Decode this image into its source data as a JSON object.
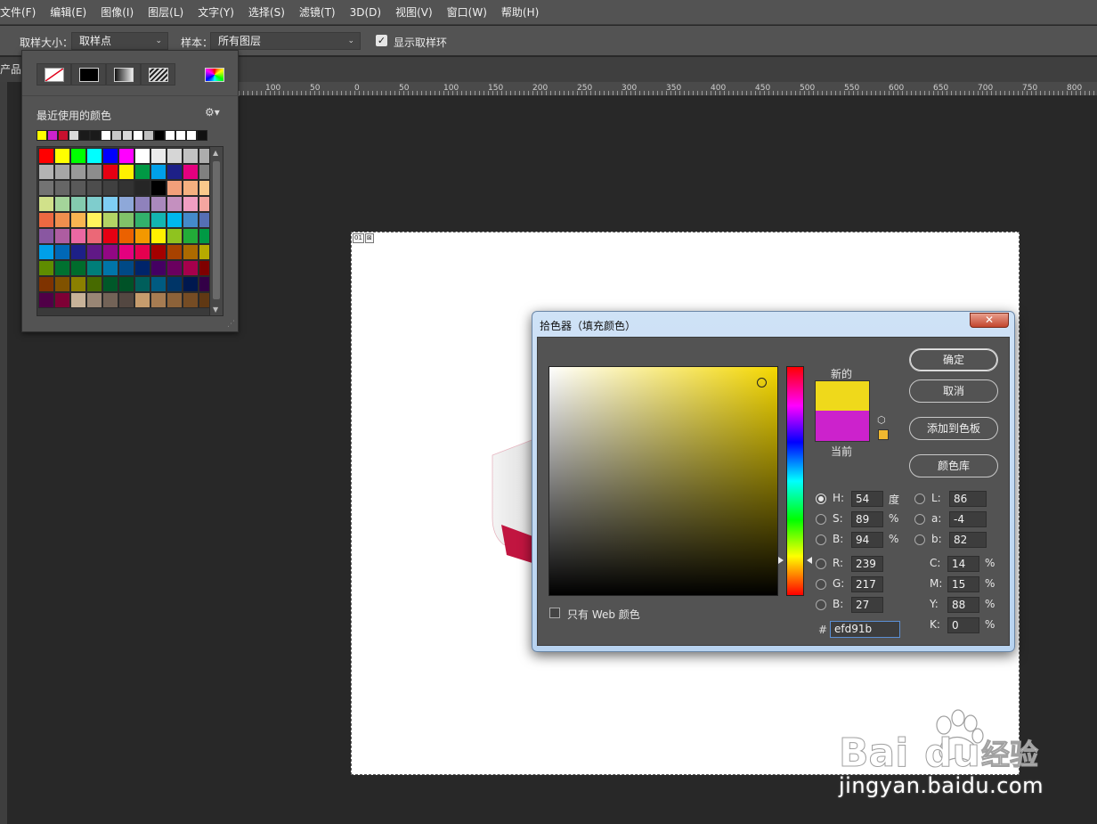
{
  "menu": [
    "文件(F)",
    "编辑(E)",
    "图像(I)",
    "图层(L)",
    "文字(Y)",
    "选择(S)",
    "滤镜(T)",
    "3D(D)",
    "视图(V)",
    "窗口(W)",
    "帮助(H)"
  ],
  "options": {
    "sample_size_label": "取样大小：",
    "sample_size_value": "取样点",
    "sample_label": "样本：",
    "sample_value": "所有图层",
    "show_ring_label": "显示取样环"
  },
  "doc_tab": "产品",
  "ruler_labels": [
    "100",
    "50",
    "0",
    "50",
    "100",
    "150",
    "200",
    "250",
    "300",
    "350",
    "400",
    "450",
    "500",
    "550",
    "600",
    "650",
    "700",
    "750",
    "800"
  ],
  "doc_badge": [
    "01",
    "⊠"
  ],
  "swatch_panel": {
    "recent_title": "最近使用的颜色",
    "recent_colors": [
      "#ffff00",
      "#cc22cc",
      "#c8102e",
      "#d9d9d9",
      "#1a1a1a",
      "#1a1a1a",
      "#ffffff",
      "#c8c8c8",
      "#d9d9d9",
      "#ffffff",
      "#bfbfbf",
      "#000000",
      "#ffffff",
      "#ffffff",
      "#ffffff",
      "#111111"
    ],
    "grid_colors": [
      "#ff0000",
      "#ffff00",
      "#00ff00",
      "#00ffff",
      "#0000ff",
      "#ff00ff",
      "#ffffff",
      "#ebebeb",
      "#d6d6d6",
      "#c2c2c2",
      "#adadad",
      "#b3b3b3",
      "#a6a6a6",
      "#999999",
      "#8c8c8c",
      "#e60012",
      "#fff100",
      "#009944",
      "#00a0e9",
      "#1d2088",
      "#e4007f",
      "#808080",
      "#737373",
      "#666666",
      "#595959",
      "#4d4d4d",
      "#404040",
      "#333333",
      "#262626",
      "#000000",
      "#f19f7a",
      "#f5b080",
      "#f9c98b",
      "#d1e18a",
      "#a4d49a",
      "#84cbaf",
      "#7fcdcd",
      "#7ecef4",
      "#8ea8d9",
      "#8f82bc",
      "#aa89bd",
      "#c490bf",
      "#f19ec2",
      "#f4a6a0",
      "#ec6941",
      "#f08f4e",
      "#f8b551",
      "#fff45c",
      "#b3d465",
      "#80c269",
      "#32b16c",
      "#13b5b1",
      "#00b7ee",
      "#448aca",
      "#556fb5",
      "#8957a1",
      "#ae5da1",
      "#ea68a2",
      "#eb6877",
      "#e60012",
      "#eb6100",
      "#f39800",
      "#fff100",
      "#8fc31f",
      "#22ac38",
      "#009944",
      "#00a0e9",
      "#0068b7",
      "#1d2088",
      "#601986",
      "#920783",
      "#e4007f",
      "#e5004f",
      "#a40000",
      "#a84200",
      "#ac6a00",
      "#b7aa00",
      "#5f8c00",
      "#007130",
      "#006c2c",
      "#007e79",
      "#0075a9",
      "#004986",
      "#00246a",
      "#440062",
      "#6a005f",
      "#a5004c",
      "#7e0000",
      "#7f3300",
      "#805200",
      "#8b8000",
      "#476a00",
      "#005829",
      "#005227",
      "#005e5b",
      "#005b81",
      "#003567",
      "#00184f",
      "#330047",
      "#500047",
      "#7e0035",
      "#c7b299",
      "#998675",
      "#736357",
      "#534741",
      "#c69c6d",
      "#a67c52",
      "#8c6239",
      "#754c24",
      "#603813"
    ]
  },
  "dialog": {
    "title": "拾色器（填充颜色）",
    "close": "✕",
    "label_new": "新的",
    "label_current": "当前",
    "new_color": "#efd91b",
    "current_color": "#cc22cc",
    "buttons": {
      "ok": "确定",
      "cancel": "取消",
      "add_swatch": "添加到色板",
      "color_libraries": "颜色库"
    },
    "hsb": {
      "h_label": "H:",
      "h": "54",
      "h_unit": "度",
      "s_label": "S:",
      "s": "89",
      "s_unit": "%",
      "b_label": "B:",
      "b": "94",
      "b_unit": "%"
    },
    "lab": {
      "l_label": "L:",
      "l": "86",
      "a_label": "a:",
      "a": "-4",
      "b_label": "b:",
      "b": "82"
    },
    "rgb": {
      "r_label": "R:",
      "r": "239",
      "g_label": "G:",
      "g": "217",
      "b_label": "B:",
      "b": "27"
    },
    "cmyk": {
      "c_label": "C:",
      "c": "14",
      "m_label": "M:",
      "m": "15",
      "y_label": "Y:",
      "y": "88",
      "k_label": "K:",
      "k": "0",
      "unit": "%"
    },
    "web_only_label": "只有 Web 颜色",
    "hex_label": "#",
    "hex": "efd91b"
  },
  "watermark": {
    "brand": "Bai du 经验",
    "url": "jingyan.baidu.com"
  }
}
